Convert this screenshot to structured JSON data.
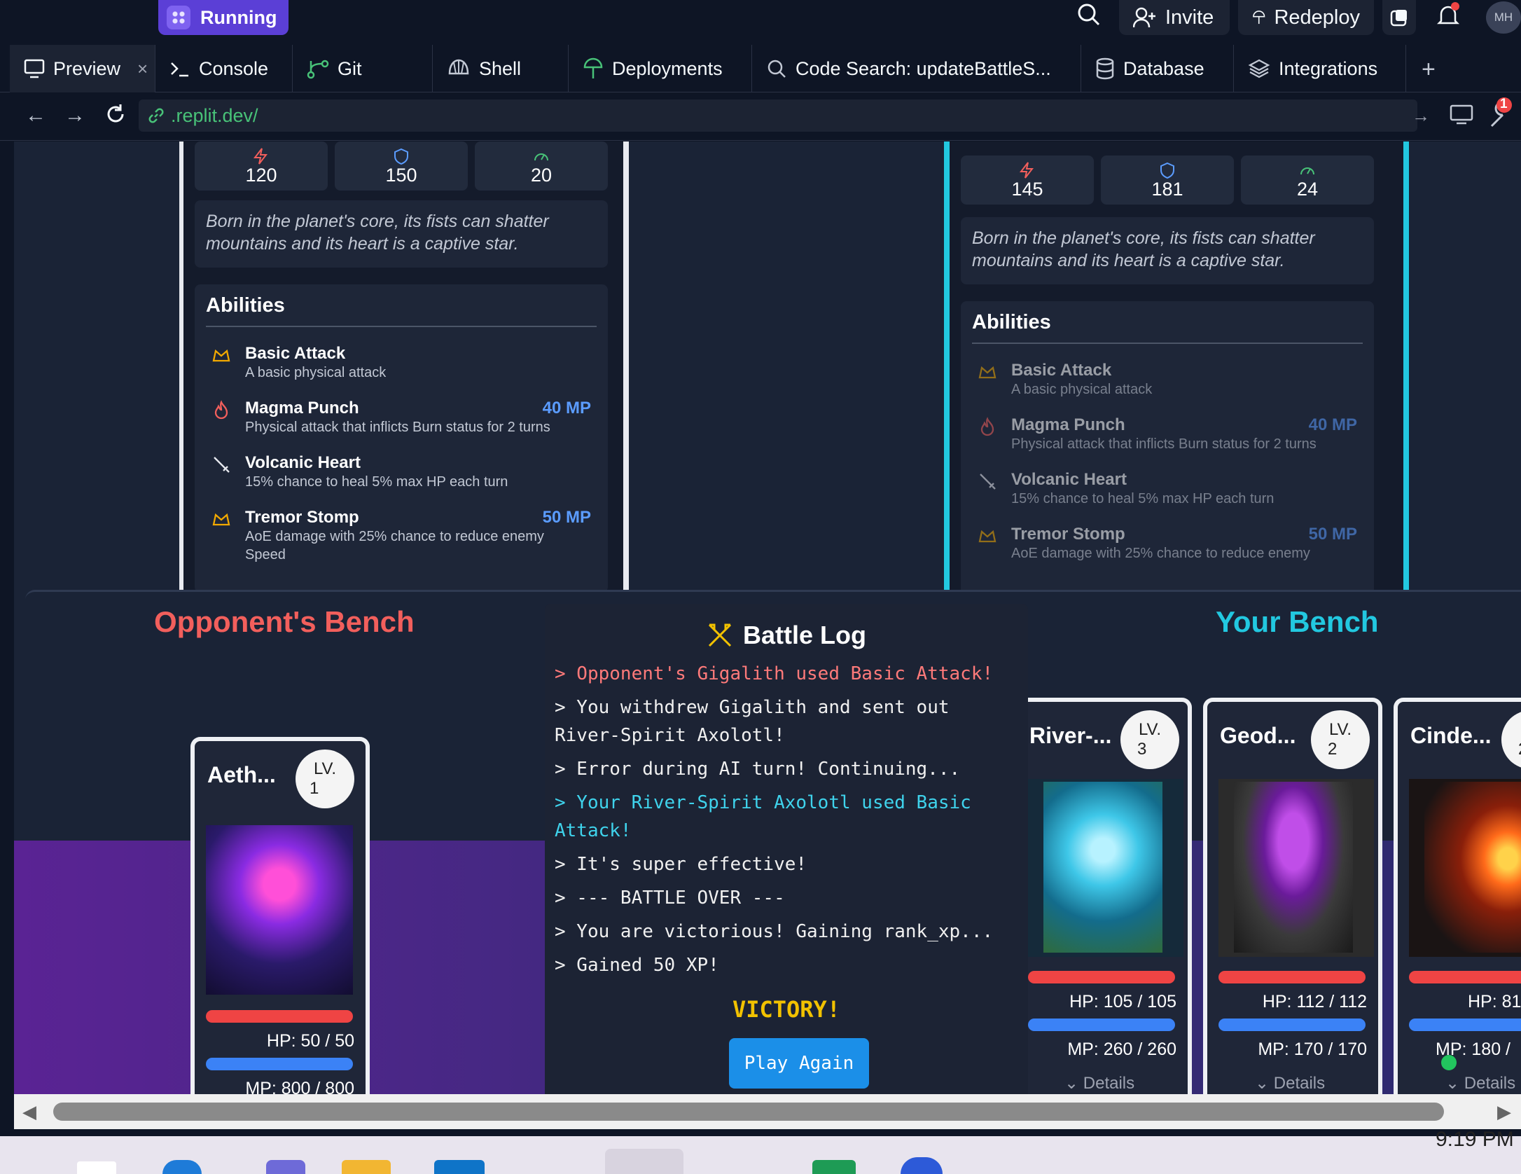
{
  "topbar": {
    "status": "Running",
    "invite": "Invite",
    "redeploy": "Redeploy",
    "avatar_initials": "MH"
  },
  "tabs": [
    {
      "label": "Preview"
    },
    {
      "label": "Console"
    },
    {
      "label": "Git"
    },
    {
      "label": "Shell"
    },
    {
      "label": "Deployments"
    },
    {
      "label": "Code Search: updateBattleS..."
    },
    {
      "label": "Database"
    },
    {
      "label": "Integrations"
    }
  ],
  "browser": {
    "url": ".replit.dev/",
    "notification_count": "1"
  },
  "left_card": {
    "stats": {
      "attack": "120",
      "defense": "150",
      "speed": "20"
    },
    "description": "Born in the planet's core, its fists can shatter mountains and its heart is a captive star.",
    "abilities_title": "Abilities",
    "abilities": [
      {
        "name": "Basic Attack",
        "desc": "A basic physical attack",
        "mp": ""
      },
      {
        "name": "Magma Punch",
        "desc": "Physical attack that inflicts Burn status for 2 turns",
        "mp": "40 MP"
      },
      {
        "name": "Volcanic Heart",
        "desc": "15% chance to heal 5% max HP each turn",
        "mp": ""
      },
      {
        "name": "Tremor Stomp",
        "desc": "AoE damage with 25% chance to reduce enemy Speed",
        "mp": "50 MP"
      }
    ]
  },
  "right_card": {
    "stats": {
      "attack": "145",
      "defense": "181",
      "speed": "24"
    },
    "description": "Born in the planet's core, its fists can shatter mountains and its heart is a captive star.",
    "abilities_title": "Abilities",
    "abilities": [
      {
        "name": "Basic Attack",
        "desc": "A basic physical attack",
        "mp": ""
      },
      {
        "name": "Magma Punch",
        "desc": "Physical attack that inflicts Burn status for 2 turns",
        "mp": "40 MP"
      },
      {
        "name": "Volcanic Heart",
        "desc": "15% chance to heal 5% max HP each turn",
        "mp": ""
      },
      {
        "name": "Tremor Stomp",
        "desc": "AoE damage with 25% chance to reduce enemy",
        "mp": "50 MP"
      }
    ]
  },
  "opponent_bench": {
    "title": "Opponent's Bench",
    "creatures": [
      {
        "name": "Aeth...",
        "lv_label": "LV.",
        "lv": "1",
        "hp": "HP: 50 / 50",
        "mp": "MP: 800 / 800"
      }
    ]
  },
  "your_bench": {
    "title": "Your Bench",
    "details_label": "Details",
    "creatures": [
      {
        "name": "River-...",
        "lv_label": "LV.",
        "lv": "3",
        "hp": "HP: 105 / 105",
        "mp": "MP: 260 / 260"
      },
      {
        "name": "Geod...",
        "lv_label": "LV.",
        "lv": "2",
        "hp": "HP: 112 / 112",
        "mp": "MP: 170 / 170"
      },
      {
        "name": "Cinde...",
        "lv_label": "L",
        "lv": "2",
        "hp": "HP: 81",
        "mp": "MP: 180 /"
      }
    ]
  },
  "battle_log": {
    "title": "Battle Log",
    "lines": [
      {
        "text": "> Opponent's Gigalith used Basic Attack!",
        "kind": "opponent"
      },
      {
        "text": "> You withdrew Gigalith and sent out River-Spirit Axolotl!",
        "kind": "normal"
      },
      {
        "text": "> Error during AI turn! Continuing...",
        "kind": "normal"
      },
      {
        "text": "> Your River-Spirit Axolotl used Basic Attack!",
        "kind": "player"
      },
      {
        "text": "> It's super effective!",
        "kind": "normal"
      },
      {
        "text": "> --- BATTLE OVER ---",
        "kind": "normal"
      },
      {
        "text": "> You are victorious! Gaining rank_xp...",
        "kind": "normal"
      },
      {
        "text": "> Gained 50 XP!",
        "kind": "normal"
      }
    ],
    "result": "VICTORY!",
    "play_again": "Play Again"
  },
  "taskbar": {
    "clock": "9:19 PM"
  },
  "colors": {
    "accent_purple": "#5b3fd6",
    "opponent_red": "#f25f5c",
    "player_cyan": "#22c8e0",
    "victory_gold": "#f2c200",
    "hp_bar": "#ef4444",
    "mp_bar": "#3b82f6",
    "mp_text": "#5b9cff"
  }
}
